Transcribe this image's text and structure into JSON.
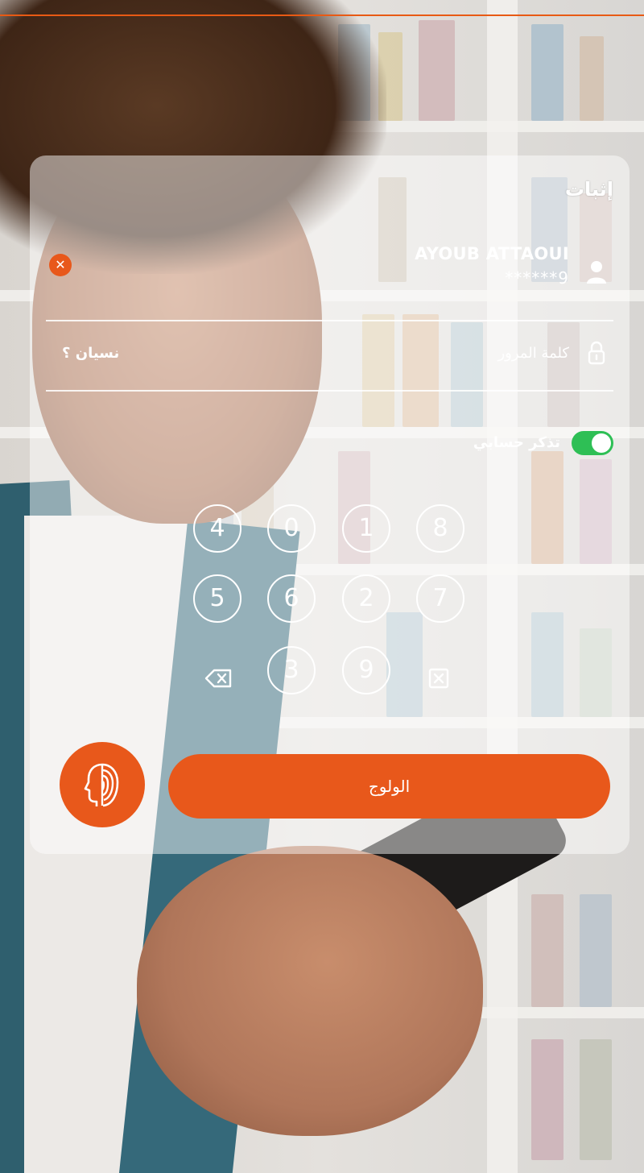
{
  "card": {
    "title": "إثبات",
    "user": {
      "name": "AYOUB ATTAOUI",
      "masked_id": "******9",
      "icon": "user-icon",
      "remove_icon": "close-icon"
    },
    "password": {
      "label": "كلمة المرور",
      "icon": "lock-icon",
      "forgot_label": "نسيان ؟"
    },
    "remember": {
      "label": "تذكر حسابي",
      "enabled": true
    },
    "keypad": {
      "rows": [
        [
          "4",
          "0",
          "1",
          "8"
        ],
        [
          "5",
          "6",
          "2",
          "7"
        ],
        [
          "3",
          "9"
        ]
      ],
      "backspace_icon": "backspace-icon",
      "clear_icon": "clear-icon"
    },
    "biometric_icon": "face-fingerprint-icon",
    "login_label": "الولوج"
  },
  "colors": {
    "accent": "#e8581b",
    "toggle_on": "#2ebf55",
    "text": "#ffffff"
  }
}
